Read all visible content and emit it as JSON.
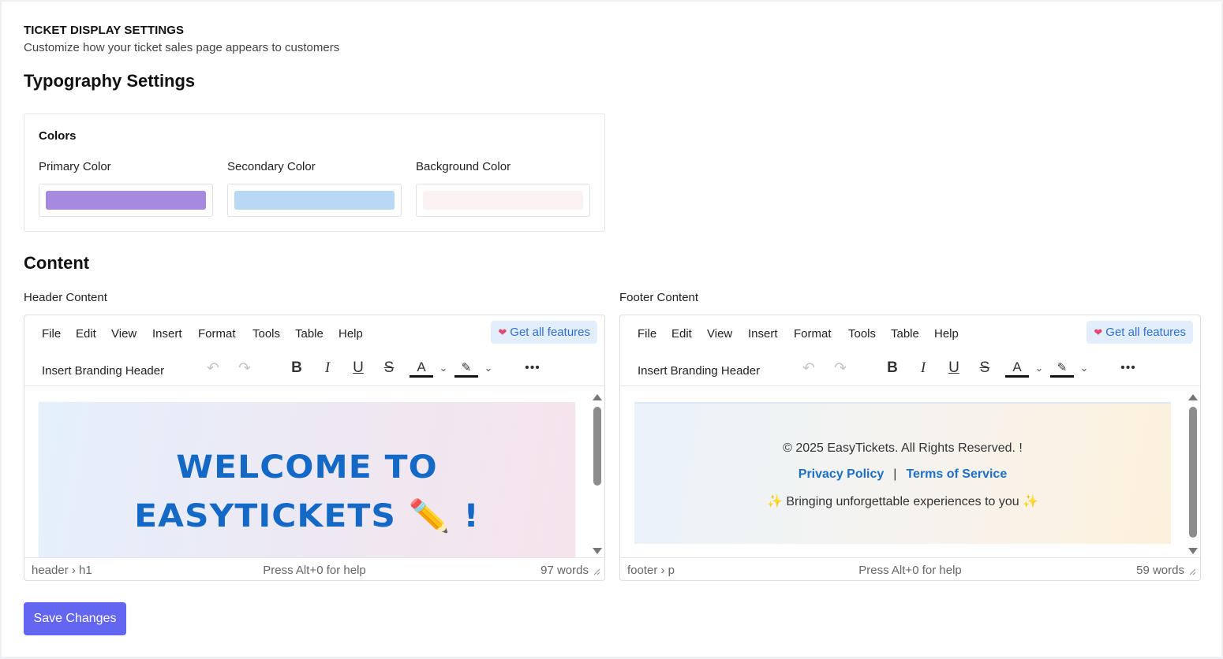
{
  "section": {
    "title": "TICKET DISPLAY SETTINGS",
    "subtitle": "Customize how your ticket sales page appears to customers"
  },
  "typography": {
    "heading": "Typography Settings",
    "colors_title": "Colors",
    "colors": [
      {
        "label": "Primary Color",
        "value": "#a58adf"
      },
      {
        "label": "Secondary Color",
        "value": "#b8d8f6"
      },
      {
        "label": "Background Color",
        "value": "#fbf3f3"
      }
    ]
  },
  "content": {
    "heading": "Content",
    "header_editor": {
      "label": "Header Content",
      "menu": [
        "File",
        "Edit",
        "View",
        "Insert",
        "Format",
        "Tools",
        "Table",
        "Help"
      ],
      "get_features": "Get all features",
      "block_dropdown": "Insert Branding Header",
      "hero_line1": "WELCOME TO",
      "hero_line2": "EASYTICKETS ✏️ !",
      "status_path": "header › h1",
      "status_help": "Press Alt+0 for help",
      "status_words": "97 words"
    },
    "footer_editor": {
      "label": "Footer Content",
      "menu": [
        "File",
        "Edit",
        "View",
        "Insert",
        "Format",
        "Tools",
        "Table",
        "Help"
      ],
      "get_features": "Get all features",
      "block_dropdown": "Insert Branding Header",
      "copyright": "© 2025 EasyTickets. All Rights Reserved. !",
      "privacy": "Privacy Policy",
      "separator": "|",
      "terms": "Terms of Service",
      "tagline": "Bringing unforgettable experiences to you",
      "status_path": "footer › p",
      "status_help": "Press Alt+0 for help",
      "status_words": "59 words"
    }
  },
  "actions": {
    "save": "Save Changes"
  },
  "theme": {
    "accent": "#6366f1",
    "link": "#1c6fc6",
    "hero_text": "#1469c7"
  },
  "icons": {
    "undo": "undo-icon",
    "redo": "redo-icon",
    "bold": "bold-icon",
    "italic": "italic-icon",
    "underline": "underline-icon",
    "strike": "strikethrough-icon",
    "text_color": "text-color-icon",
    "highlight": "highlight-icon",
    "more": "more-icon",
    "heart": "heart-icon"
  }
}
